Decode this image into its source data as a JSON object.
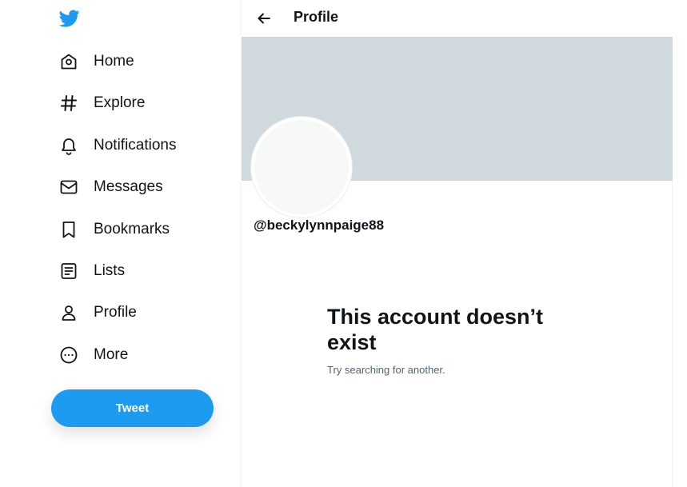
{
  "sidebar": {
    "logo": "twitter-bird-icon",
    "items": [
      {
        "label": "Home",
        "icon": "home-icon"
      },
      {
        "label": "Explore",
        "icon": "hashtag-icon"
      },
      {
        "label": "Notifications",
        "icon": "bell-icon"
      },
      {
        "label": "Messages",
        "icon": "envelope-icon"
      },
      {
        "label": "Bookmarks",
        "icon": "bookmark-icon"
      },
      {
        "label": "Lists",
        "icon": "list-icon"
      },
      {
        "label": "Profile",
        "icon": "user-icon"
      },
      {
        "label": "More",
        "icon": "more-circle-icon"
      }
    ],
    "tweet_label": "Tweet"
  },
  "header": {
    "back_icon": "back-arrow-icon",
    "title": "Profile"
  },
  "profile": {
    "handle": "@beckylynnpaige88"
  },
  "empty_state": {
    "title": "This account doesn’t exist",
    "subtitle": "Try searching for another."
  },
  "colors": {
    "brand": "#1d9bf0",
    "banner": "#cfd9de",
    "avatar": "#f7f9f9",
    "text": "#0f1419",
    "muted": "#536471"
  }
}
